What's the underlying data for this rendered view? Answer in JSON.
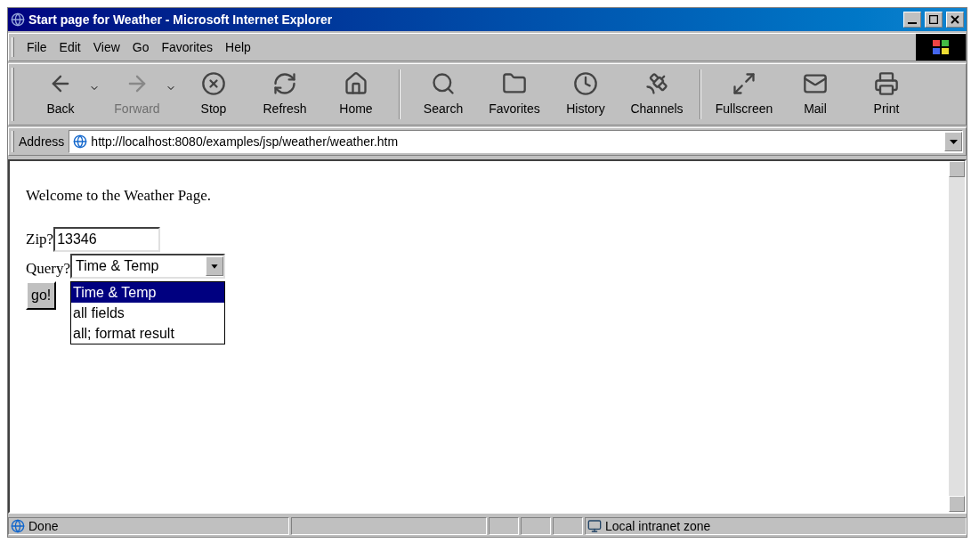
{
  "window": {
    "title": "Start page for Weather - Microsoft Internet Explorer"
  },
  "menu": [
    "File",
    "Edit",
    "View",
    "Go",
    "Favorites",
    "Help"
  ],
  "toolbar": [
    {
      "label": "Back",
      "kind": "back",
      "disabled": false,
      "dropdown": true
    },
    {
      "label": "Forward",
      "kind": "forward",
      "disabled": true,
      "dropdown": true
    },
    {
      "label": "Stop",
      "kind": "stop",
      "disabled": false,
      "dropdown": false
    },
    {
      "label": "Refresh",
      "kind": "refresh",
      "disabled": false,
      "dropdown": false
    },
    {
      "label": "Home",
      "kind": "home",
      "disabled": false,
      "dropdown": false
    },
    {
      "label": "Search",
      "kind": "search",
      "disabled": false,
      "dropdown": false
    },
    {
      "label": "Favorites",
      "kind": "favorites",
      "disabled": false,
      "dropdown": false
    },
    {
      "label": "History",
      "kind": "history",
      "disabled": false,
      "dropdown": false
    },
    {
      "label": "Channels",
      "kind": "channels",
      "disabled": false,
      "dropdown": false
    },
    {
      "label": "Fullscreen",
      "kind": "fullscreen",
      "disabled": false,
      "dropdown": false
    },
    {
      "label": "Mail",
      "kind": "mail",
      "disabled": false,
      "dropdown": false
    },
    {
      "label": "Print",
      "kind": "print",
      "disabled": false,
      "dropdown": false
    }
  ],
  "address": {
    "label": "Address",
    "value": "http://localhost:8080/examples/jsp/weather/weather.htm"
  },
  "page": {
    "heading": "Welcome to the Weather Page.",
    "zip": {
      "label": "Zip?",
      "value": "13346"
    },
    "query": {
      "label": "Query?",
      "value": "Time & Temp",
      "options": [
        {
          "label": "Time & Temp",
          "selected": true
        },
        {
          "label": "all fields",
          "selected": false
        },
        {
          "label": "all; format result",
          "selected": false
        }
      ]
    },
    "submit": "go!"
  },
  "status_bar": {
    "text": "Done",
    "zone": "Local intranet zone"
  }
}
